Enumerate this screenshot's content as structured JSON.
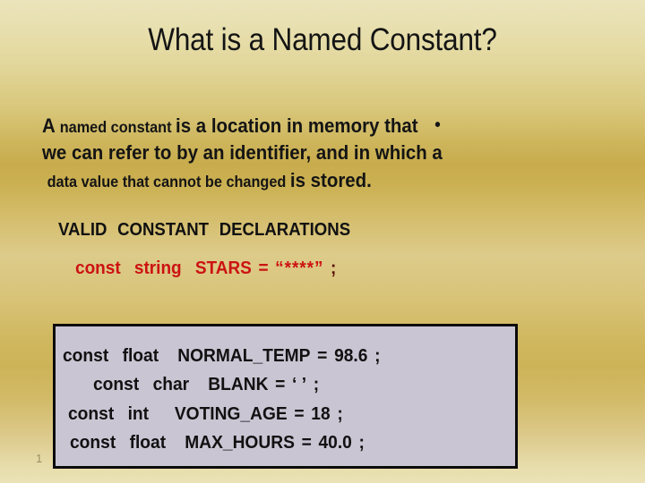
{
  "slide": {
    "title": "What is a Named Constant?",
    "page_number": "1",
    "background": {
      "top_color": "#ebe4bb",
      "mid_color": "#c8ac4c",
      "bottom_color": "#ebe3b6"
    }
  },
  "body": {
    "bullet_glyph": "•",
    "line1": {
      "part1": "A ",
      "part2": "named constant ",
      "part3": "is a ",
      "part4": "location in memory that"
    },
    "line2": {
      "text": "we can refer to by an identifier, and in which a"
    },
    "line3": {
      "part1": "data value that cannot be changed ",
      "part2": "is ",
      "part3": "stored."
    },
    "full_text": "A named constant is a location in memory that we can refer to by an identifier, and in which a data value that cannot be changed is stored."
  },
  "declarations": {
    "heading": "VALID  CONSTANT  DECLARATIONS",
    "red_color": "#cc1212",
    "sample": {
      "keyword": "const",
      "type": "string",
      "identifier": "STARS",
      "equals": "=",
      "value": "“****”",
      "terminator": ";",
      "full": "const  string  STARS  =  “****” ;"
    }
  },
  "code_box": {
    "background_color": "#c9c5d3",
    "border_color": "#0b0b0b",
    "lines": [
      {
        "keyword": "const",
        "type": "float",
        "identifier": "NORMAL_TEMP",
        "equals": "=",
        "value": "98.6",
        "terminator": ";",
        "full": "const  float    NORMAL_TEMP  =  98.6 ;"
      },
      {
        "keyword": "const",
        "type": "char",
        "identifier": "BLANK",
        "equals": "=",
        "value": "‘  ’",
        "terminator": ";",
        "full": "const  char    BLANK =  ‘  ’ ;"
      },
      {
        "keyword": "const",
        "type": "int",
        "identifier": "VOTING_AGE",
        "equals": "=",
        "value": "18",
        "terminator": ";",
        "full": "const  int     VOTING_AGE  =  18 ;"
      },
      {
        "keyword": "const",
        "type": "float",
        "identifier": "MAX_HOURS",
        "equals": "=",
        "value": "40.0",
        "terminator": ";",
        "full": "const  float    MAX_HOURS  =  40.0 ;"
      }
    ]
  }
}
